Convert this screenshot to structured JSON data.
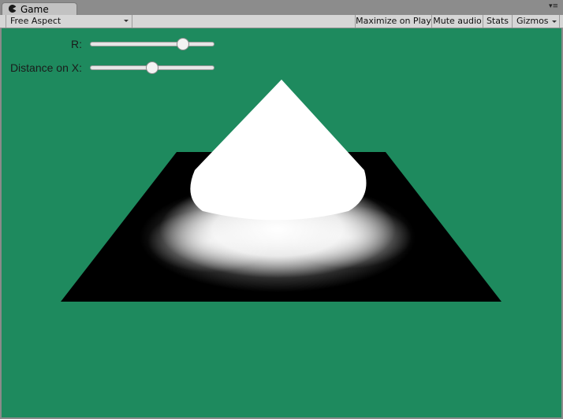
{
  "tab": {
    "title": "Game",
    "icon": "pacman-icon"
  },
  "toolbar": {
    "aspect": "Free Aspect",
    "maximize_on_play": "Maximize on Play",
    "mute_audio": "Mute audio",
    "stats": "Stats",
    "gizmos": "Gizmos"
  },
  "window_menu_icon": "▾≡",
  "scene": {
    "background_color": "#1e8a5e",
    "plane_color": "#000000",
    "cone_color": "#ffffff"
  },
  "sliders": [
    {
      "label": "R:",
      "value": 0.77
    },
    {
      "label": "Distance on X:",
      "value": 0.49
    }
  ]
}
